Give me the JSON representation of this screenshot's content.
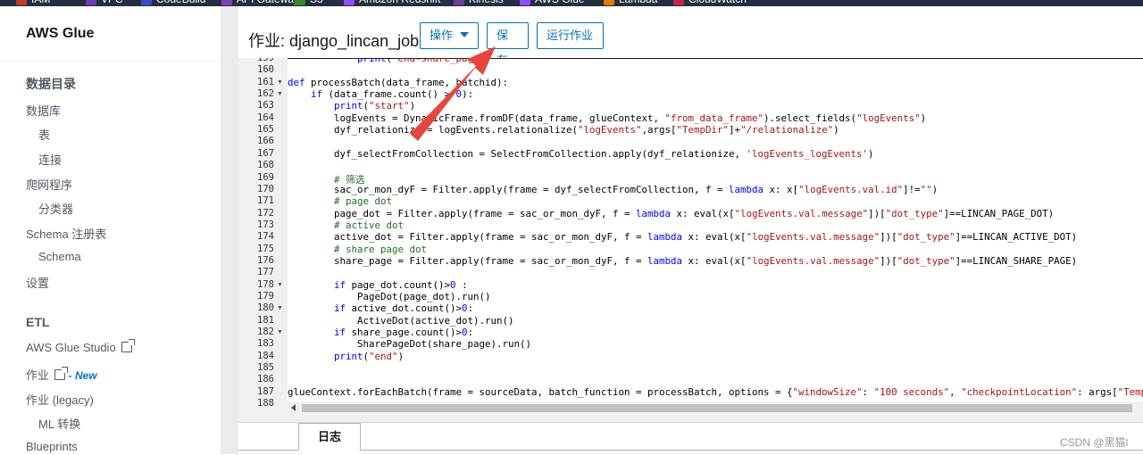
{
  "bookmarks": [
    "IAM",
    "VPC",
    "CodeBuild",
    "API Gateway",
    "S3",
    "Amazon Redshift",
    "Kinesis",
    "AWS Glue",
    "Lambda",
    "CloudWatch"
  ],
  "sidebar": {
    "brand": "AWS Glue",
    "items": [
      {
        "label": "数据目录"
      },
      {
        "label": "数据库"
      },
      {
        "label": "表"
      },
      {
        "label": "连接"
      },
      {
        "label": "爬网程序"
      },
      {
        "label": "分类器"
      },
      {
        "label": "Schema 注册表"
      },
      {
        "label": "Schema"
      },
      {
        "label": "设置"
      },
      {
        "label": "ETL"
      },
      {
        "label": "AWS Glue Studio"
      },
      {
        "label": "作业"
      },
      {
        "label": "作业 (legacy)"
      },
      {
        "label": "ML 转换"
      },
      {
        "label": "Blueprints"
      }
    ],
    "new_badge": "- New"
  },
  "header": {
    "title": "作业: django_lincan_job",
    "actions_label": "操作",
    "save_label": "保存",
    "run_label": "运行作业"
  },
  "editor": {
    "lines": [
      {
        "n": "159",
        "t": "            print(\"end-share_page\")"
      },
      {
        "n": "160",
        "t": ""
      },
      {
        "n": "161",
        "t": "def processBatch(data_frame, batchid):"
      },
      {
        "n": "162",
        "t": "    if (data_frame.count() > 0):"
      },
      {
        "n": "163",
        "t": "        print(\"start\")"
      },
      {
        "n": "164",
        "t": "        logEvents = DynamicFrame.fromDF(data_frame, glueContext, \"from_data_frame\").select_fields(\"logEvents\")"
      },
      {
        "n": "165",
        "t": "        dyf_relationize = logEvents.relationalize(\"logEvents\",args[\"TempDir\"]+\"/relationalize\")"
      },
      {
        "n": "166",
        "t": ""
      },
      {
        "n": "167",
        "t": "        dyf_selectFromCollection = SelectFromCollection.apply(dyf_relationize, 'logEvents_logEvents')"
      },
      {
        "n": "168",
        "t": ""
      },
      {
        "n": "169",
        "t": "        # 筛选"
      },
      {
        "n": "170",
        "t": "        sac_or_mon_dyF = Filter.apply(frame = dyf_selectFromCollection, f = lambda x: x[\"logEvents.val.id\"]!=\"\")"
      },
      {
        "n": "171",
        "t": "        # page dot"
      },
      {
        "n": "172",
        "t": "        page_dot = Filter.apply(frame = sac_or_mon_dyF, f = lambda x: eval(x[\"logEvents.val.message\"])[\"dot_type\"]==LINCAN_PAGE_DOT)"
      },
      {
        "n": "173",
        "t": "        # active dot"
      },
      {
        "n": "174",
        "t": "        active_dot = Filter.apply(frame = sac_or_mon_dyF, f = lambda x: eval(x[\"logEvents.val.message\"])[\"dot_type\"]==LINCAN_ACTIVE_DOT)"
      },
      {
        "n": "175",
        "t": "        # share page dot"
      },
      {
        "n": "176",
        "t": "        share_page = Filter.apply(frame = sac_or_mon_dyF, f = lambda x: eval(x[\"logEvents.val.message\"])[\"dot_type\"]==LINCAN_SHARE_PAGE)"
      },
      {
        "n": "177",
        "t": ""
      },
      {
        "n": "178",
        "t": "        if page_dot.count()>0 :"
      },
      {
        "n": "179",
        "t": "            PageDot(page_dot).run()"
      },
      {
        "n": "180",
        "t": "        if active_dot.count()>0:"
      },
      {
        "n": "181",
        "t": "            ActiveDot(active_dot).run()"
      },
      {
        "n": "182",
        "t": "        if share_page.count()>0:"
      },
      {
        "n": "183",
        "t": "            SharePageDot(share_page).run()"
      },
      {
        "n": "184",
        "t": "        print(\"end\")"
      },
      {
        "n": "185",
        "t": ""
      },
      {
        "n": "186",
        "t": ""
      },
      {
        "n": "187",
        "t": "glueContext.forEachBatch(frame = sourceData, batch_function = processBatch, options = {\"windowSize\": \"100 seconds\", \"checkpointLocation\": args[\"TempDir\"]"
      },
      {
        "n": "188",
        "t": ""
      }
    ],
    "fold_lines": [
      "161",
      "162",
      "178",
      "180",
      "182"
    ]
  },
  "tabs": {
    "log_label": "日志"
  },
  "watermark": "CSDN @黑猫l"
}
